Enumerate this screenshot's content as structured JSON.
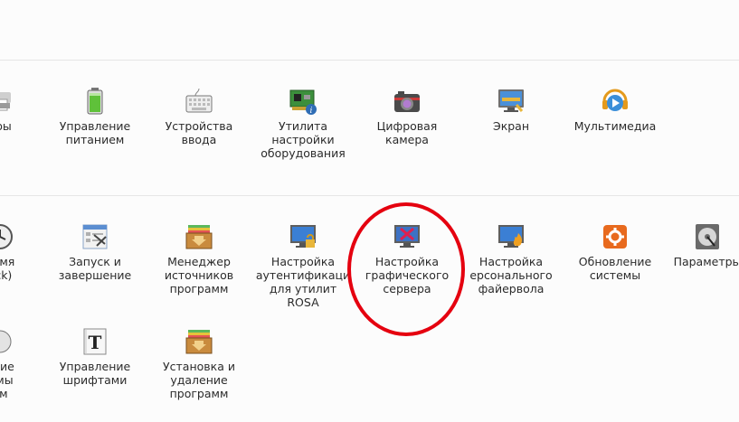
{
  "sections": [
    {
      "items": [
        {
          "label": "еры",
          "icon": "printer-icon"
        },
        {
          "label": "Управление\nпитанием",
          "icon": "battery-icon"
        },
        {
          "label": "Устройства\nввода",
          "icon": "keyboard-icon"
        },
        {
          "label": "Утилита\nнастройки\nоборудования",
          "icon": "hardware-card-icon"
        },
        {
          "label": "Цифровая\nкамера",
          "icon": "camera-icon"
        },
        {
          "label": "Экран",
          "icon": "display-icon"
        },
        {
          "label": "Мультимедиа",
          "icon": "multimedia-icon"
        }
      ]
    },
    {
      "items": [
        {
          "label": "ремя\nock)",
          "icon": "clock-icon"
        },
        {
          "label": "Запуск и\nзавершение",
          "icon": "startup-icon"
        },
        {
          "label": "Менеджер\nисточников\nпрограмм",
          "icon": "package-box-icon"
        },
        {
          "label": "Настройка\nаутентификаци\nдля утилит ROSA",
          "icon": "monitor-lock-icon"
        },
        {
          "label": "Настройка\nграфического\nсервера",
          "icon": "monitor-x-icon"
        },
        {
          "label": "Настройка\nерсонального\nфайервола",
          "icon": "monitor-flame-icon"
        },
        {
          "label": "Обновление\nсистемы",
          "icon": "update-icon"
        },
        {
          "label": "Параметры",
          "icon": "disk-icon"
        }
      ]
    },
    {
      "items": [
        {
          "label": "ение\nымы\nам",
          "icon": "generic-icon"
        },
        {
          "label": "Управление\nшрифтами",
          "icon": "font-icon"
        },
        {
          "label": "Установка и\nудаление\nпрограмм",
          "icon": "package-box-icon"
        }
      ]
    }
  ],
  "colors": {
    "highlight": "#e5000f",
    "accent": "#2d6fb3"
  }
}
